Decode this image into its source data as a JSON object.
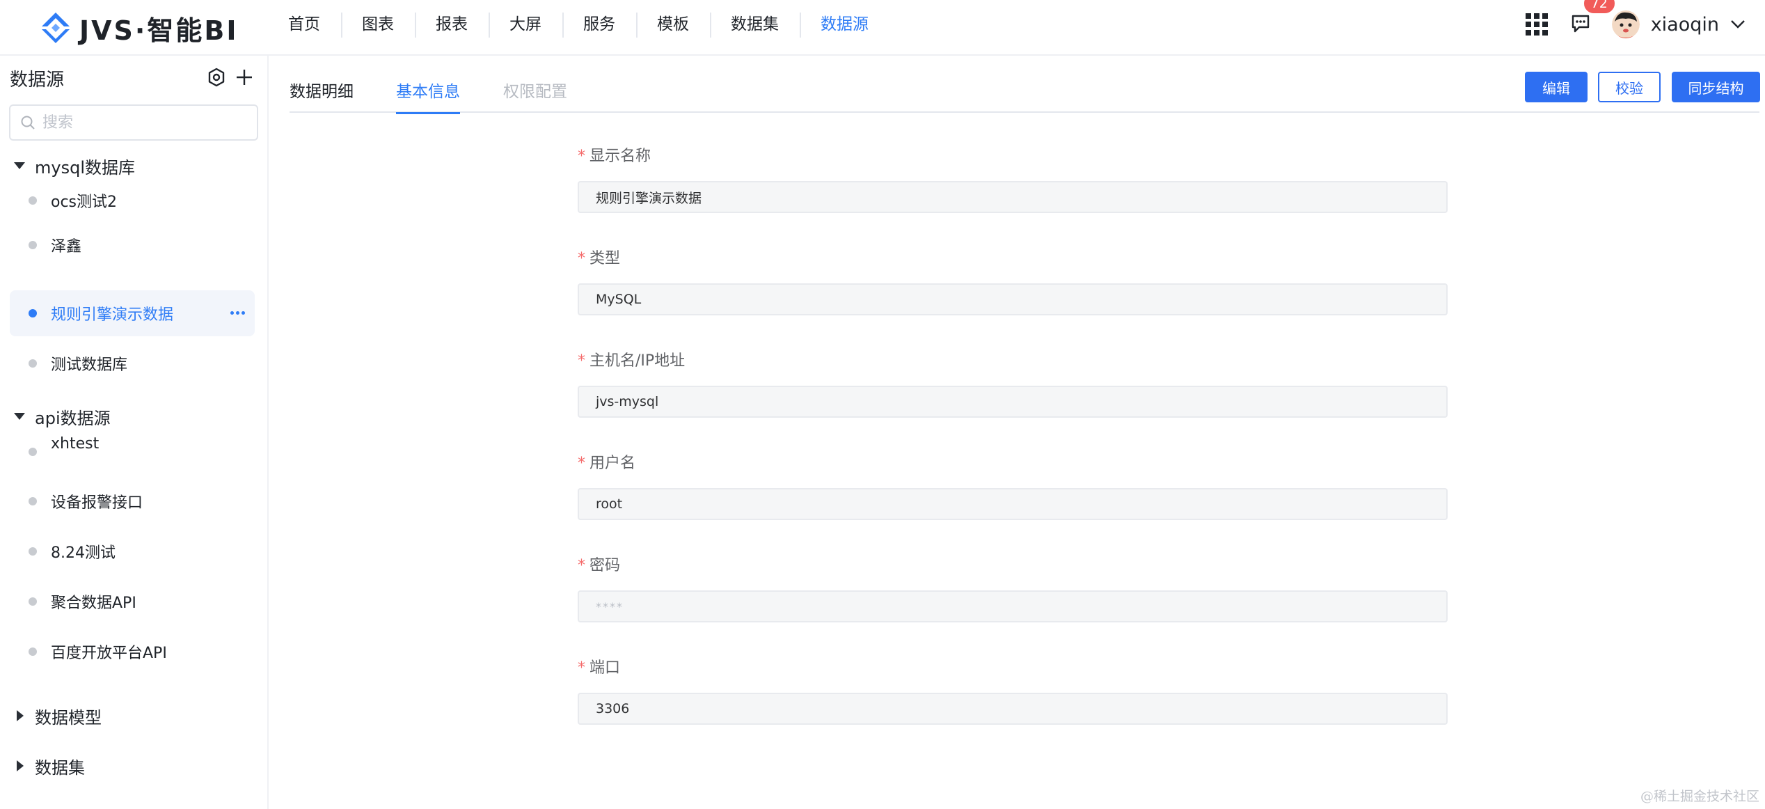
{
  "app": {
    "logo_text": "JVS·智能BI",
    "brand_color": "#2e7cf6"
  },
  "nav": {
    "items": [
      {
        "label": "首页"
      },
      {
        "label": "图表"
      },
      {
        "label": "报表"
      },
      {
        "label": "大屏"
      },
      {
        "label": "服务"
      },
      {
        "label": "模板"
      },
      {
        "label": "数据集"
      },
      {
        "label": "数据源",
        "active": true
      }
    ]
  },
  "header": {
    "notification_count": "72",
    "username": "xiaoqin",
    "icons": [
      "apps-grid-icon",
      "message-icon",
      "avatar",
      "chevron-down-icon"
    ]
  },
  "sidebar": {
    "title": "数据源",
    "search_placeholder": "搜索",
    "groups": [
      {
        "label": "mysql数据库",
        "expanded": true,
        "items": [
          {
            "label": "ocs测试2"
          },
          {
            "label": "泽鑫"
          },
          {
            "label": "规则引擎演示数据",
            "selected": true
          },
          {
            "label": "测试数据库"
          }
        ]
      },
      {
        "label": "api数据源",
        "expanded": true,
        "items": [
          {
            "label": "xhtest"
          },
          {
            "label": "设备报警接口"
          },
          {
            "label": "8.24测试"
          },
          {
            "label": "聚合数据API"
          },
          {
            "label": "百度开放平台API"
          }
        ]
      },
      {
        "label": "数据模型",
        "expanded": false
      },
      {
        "label": "数据集",
        "expanded": false
      }
    ]
  },
  "main": {
    "tabs": [
      {
        "label": "数据明细"
      },
      {
        "label": "基本信息",
        "active": true
      },
      {
        "label": "权限配置",
        "disabled": true
      }
    ],
    "actions": {
      "edit": "编辑",
      "verify": "校验",
      "sync": "同步结构"
    },
    "form": [
      {
        "label": "显示名称",
        "value": "规则引擎演示数据",
        "required": true
      },
      {
        "label": "类型",
        "value": "MySQL",
        "required": true
      },
      {
        "label": "主机名/IP地址",
        "value": "jvs-mysql",
        "required": true
      },
      {
        "label": "用户名",
        "value": "root",
        "required": true
      },
      {
        "label": "密码",
        "value": "****",
        "required": true
      },
      {
        "label": "端口",
        "value": "3306",
        "required": true
      }
    ]
  },
  "watermark": "@稀土掘金技术社区"
}
